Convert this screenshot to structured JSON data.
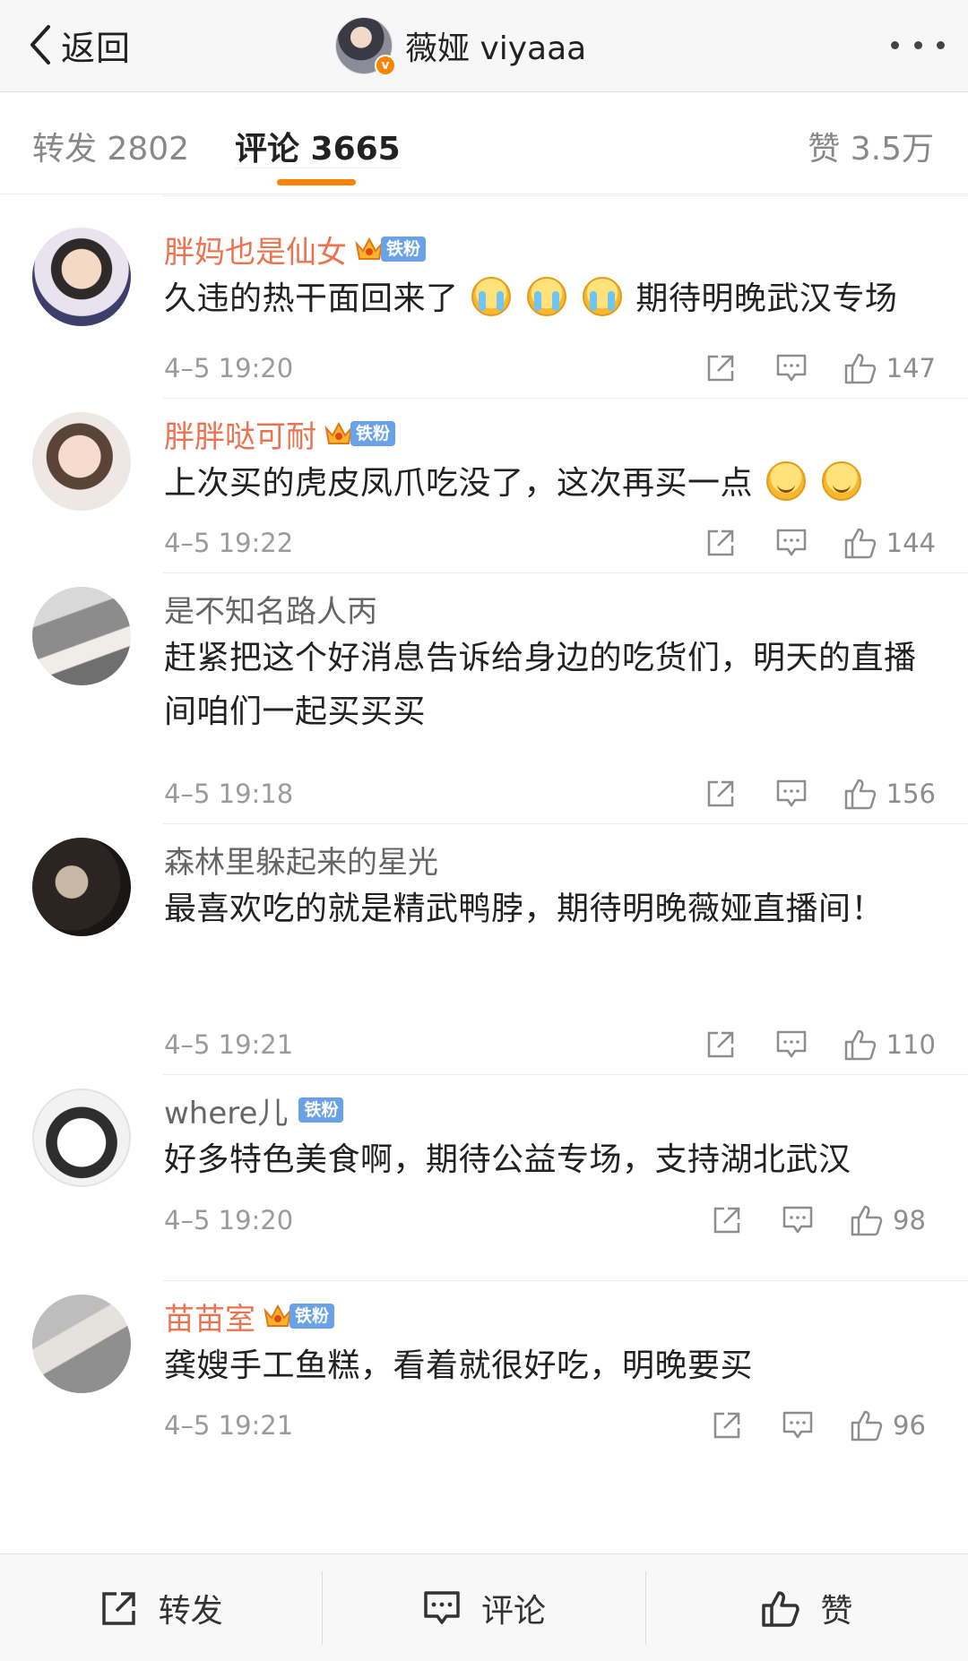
{
  "header": {
    "back_label": "返回",
    "title": "薇娅 viyaaa",
    "verified_badge": "v"
  },
  "tabs": {
    "forward": "转发 2802",
    "comment": "评论 3665",
    "like": "赞 3.5万"
  },
  "comments": [
    {
      "username": "胖妈也是仙女",
      "vip": true,
      "crown": true,
      "badge": "铁粉",
      "text": "久违的热干面回来了",
      "emojis_after_text": [
        "crying-laughing-emoji",
        "crying-laughing-emoji",
        "crying-laughing-emoji"
      ],
      "text_tail": "期待明晚武汉专场",
      "time": "4–5 19:20",
      "likes": "147"
    },
    {
      "username": "胖胖哒可耐",
      "vip": true,
      "crown": true,
      "badge": "铁粉",
      "text": "上次买的虎皮凤爪吃没了，这次再买一点",
      "emojis_after_text": [
        "smile-emoji",
        "smile-emoji"
      ],
      "time": "4–5 19:22",
      "likes": "144"
    },
    {
      "username": "是不知名路人丙",
      "vip": false,
      "text": "赶紧把这个好消息告诉给身边的吃货们，明天的直播间咱们一起买买买",
      "time": "4–5 19:18",
      "likes": "156"
    },
    {
      "username": "森林里躲起来的星光",
      "vip": false,
      "text": "最喜欢吃的就是精武鸭脖，期待明晚薇娅直播间！",
      "time": "4–5 19:21",
      "likes": "110"
    },
    {
      "username": "where儿",
      "vip": false,
      "badge": "铁粉",
      "text": "好多特色美食啊，期待公益专场，支持湖北武汉",
      "time": "4–5 19:20",
      "likes": "98"
    },
    {
      "username": "苗苗室",
      "vip": true,
      "crown": true,
      "badge": "铁粉",
      "text": "龚嫂手工鱼糕，看着就很好吃，明晚要买",
      "time": "4–5 19:21",
      "likes": "96"
    }
  ],
  "bottom_bar": {
    "forward": "转发",
    "comment": "评论",
    "like": "赞"
  },
  "colors": {
    "accent": "#ff8200",
    "vip_name": "#eb7350",
    "badge_blue": "#6aa2e8"
  }
}
